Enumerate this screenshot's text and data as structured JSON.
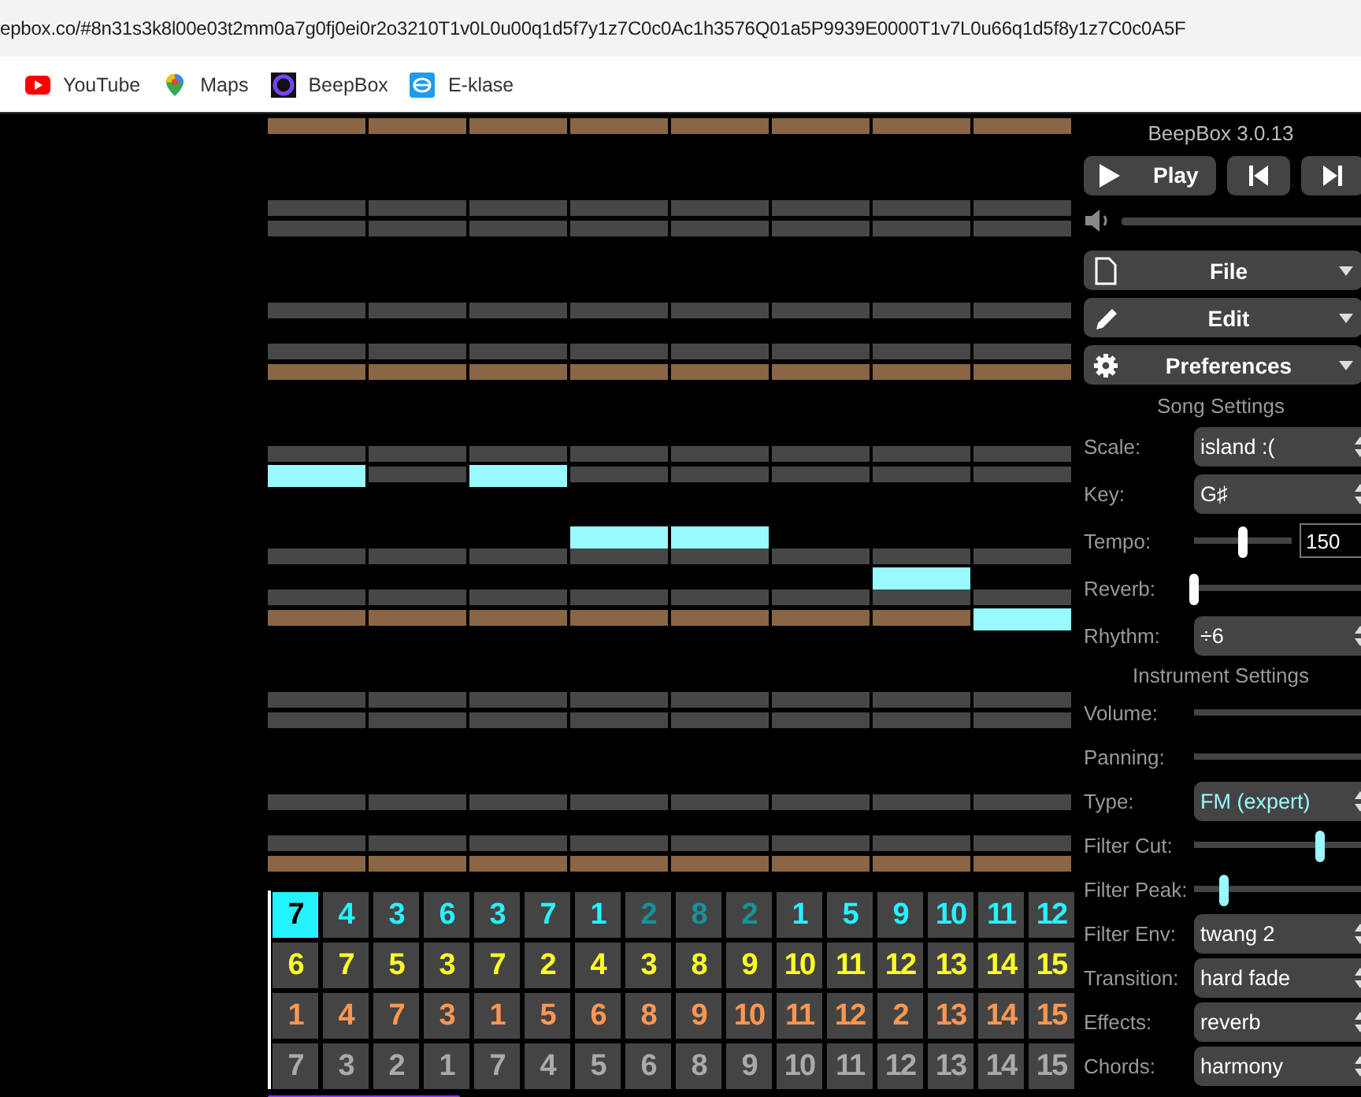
{
  "browser": {
    "url": "epbox.co/#8n31s3k8l00e03t2mm0a7g0fj0ei0r2o3210T1v0L0u00q1d5f7y1z7C0c0Ac1h3576Q01a5P9939E0000T1v7L0u66q1d5f8y1z7C0c0A5F",
    "bookmarks": [
      {
        "kind": "youtube",
        "label": "YouTube"
      },
      {
        "kind": "maps",
        "label": "Maps"
      },
      {
        "kind": "beepbox",
        "label": "BeepBox"
      },
      {
        "kind": "eklase",
        "label": "E-klase"
      }
    ]
  },
  "note_editor": {
    "rows": [
      {
        "kind": "tonic",
        "notes": [
          false,
          false,
          false,
          false,
          false,
          false,
          false,
          false
        ]
      },
      {
        "kind": "empty",
        "notes": [
          false,
          false,
          false,
          false,
          false,
          false,
          false,
          false
        ]
      },
      {
        "kind": "empty",
        "notes": [
          false,
          false,
          false,
          false,
          false,
          false,
          false,
          false
        ]
      },
      {
        "kind": "empty",
        "notes": [
          false,
          false,
          false,
          false,
          false,
          false,
          false,
          false
        ]
      },
      {
        "kind": "key",
        "notes": [
          false,
          false,
          false,
          false,
          false,
          false,
          false,
          false
        ]
      },
      {
        "kind": "key",
        "notes": [
          false,
          false,
          false,
          false,
          false,
          false,
          false,
          false
        ]
      },
      {
        "kind": "empty",
        "notes": [
          false,
          false,
          false,
          false,
          false,
          false,
          false,
          false
        ]
      },
      {
        "kind": "empty",
        "notes": [
          false,
          false,
          false,
          false,
          false,
          false,
          false,
          false
        ]
      },
      {
        "kind": "empty",
        "notes": [
          false,
          false,
          false,
          false,
          false,
          false,
          false,
          false
        ]
      },
      {
        "kind": "key",
        "notes": [
          false,
          false,
          false,
          false,
          false,
          false,
          false,
          false
        ]
      },
      {
        "kind": "empty",
        "notes": [
          false,
          false,
          false,
          false,
          false,
          false,
          false,
          false
        ]
      },
      {
        "kind": "key",
        "notes": [
          false,
          false,
          false,
          false,
          false,
          false,
          false,
          false
        ]
      },
      {
        "kind": "tonic",
        "notes": [
          false,
          false,
          false,
          false,
          false,
          false,
          false,
          false
        ]
      },
      {
        "kind": "empty",
        "notes": [
          false,
          false,
          false,
          false,
          false,
          false,
          false,
          false
        ]
      },
      {
        "kind": "empty",
        "notes": [
          false,
          false,
          false,
          false,
          false,
          false,
          false,
          false
        ]
      },
      {
        "kind": "empty",
        "notes": [
          false,
          false,
          false,
          false,
          false,
          false,
          false,
          false
        ]
      },
      {
        "kind": "key",
        "notes": [
          false,
          false,
          false,
          false,
          false,
          false,
          false,
          false
        ]
      },
      {
        "kind": "key",
        "notes": [
          true,
          false,
          true,
          false,
          false,
          false,
          false,
          false
        ]
      },
      {
        "kind": "empty",
        "notes": [
          false,
          false,
          false,
          false,
          false,
          false,
          false,
          false
        ]
      },
      {
        "kind": "empty",
        "notes": [
          false,
          false,
          false,
          false,
          false,
          false,
          false,
          false
        ]
      },
      {
        "kind": "empty",
        "notes": [
          false,
          false,
          false,
          true,
          true,
          false,
          false,
          false
        ]
      },
      {
        "kind": "key",
        "notes": [
          false,
          false,
          false,
          false,
          false,
          false,
          false,
          false
        ]
      },
      {
        "kind": "empty",
        "notes": [
          false,
          false,
          false,
          false,
          false,
          false,
          true,
          false
        ]
      },
      {
        "kind": "key",
        "notes": [
          false,
          false,
          false,
          false,
          false,
          false,
          false,
          false
        ]
      },
      {
        "kind": "tonic",
        "notes": [
          false,
          false,
          false,
          false,
          false,
          false,
          false,
          true
        ]
      },
      {
        "kind": "empty",
        "notes": [
          false,
          false,
          false,
          false,
          false,
          false,
          false,
          false
        ]
      },
      {
        "kind": "empty",
        "notes": [
          false,
          false,
          false,
          false,
          false,
          false,
          false,
          false
        ]
      },
      {
        "kind": "empty",
        "notes": [
          false,
          false,
          false,
          false,
          false,
          false,
          false,
          false
        ]
      },
      {
        "kind": "key",
        "notes": [
          false,
          false,
          false,
          false,
          false,
          false,
          false,
          false
        ]
      },
      {
        "kind": "key",
        "notes": [
          false,
          false,
          false,
          false,
          false,
          false,
          false,
          false
        ]
      },
      {
        "kind": "empty",
        "notes": [
          false,
          false,
          false,
          false,
          false,
          false,
          false,
          false
        ]
      },
      {
        "kind": "empty",
        "notes": [
          false,
          false,
          false,
          false,
          false,
          false,
          false,
          false
        ]
      },
      {
        "kind": "empty",
        "notes": [
          false,
          false,
          false,
          false,
          false,
          false,
          false,
          false
        ]
      },
      {
        "kind": "key",
        "notes": [
          false,
          false,
          false,
          false,
          false,
          false,
          false,
          false
        ]
      },
      {
        "kind": "empty",
        "notes": [
          false,
          false,
          false,
          false,
          false,
          false,
          false,
          false
        ]
      },
      {
        "kind": "key",
        "notes": [
          false,
          false,
          false,
          false,
          false,
          false,
          false,
          false
        ]
      },
      {
        "kind": "tonic",
        "notes": [
          false,
          false,
          false,
          false,
          false,
          false,
          false,
          false
        ]
      }
    ]
  },
  "track_editor": {
    "channels": [
      {
        "color": "#25f3ff",
        "cells": [
          {
            "text": "7",
            "selected": true,
            "dim": false
          },
          {
            "text": "4",
            "selected": false,
            "dim": false
          },
          {
            "text": "3",
            "selected": false,
            "dim": false
          },
          {
            "text": "6",
            "selected": false,
            "dim": false
          },
          {
            "text": "3",
            "selected": false,
            "dim": false
          },
          {
            "text": "7",
            "selected": false,
            "dim": false
          },
          {
            "text": "1",
            "selected": false,
            "dim": false
          },
          {
            "text": "2",
            "selected": false,
            "dim": true
          },
          {
            "text": "8",
            "selected": false,
            "dim": true
          },
          {
            "text": "2",
            "selected": false,
            "dim": true
          },
          {
            "text": "1",
            "selected": false,
            "dim": false
          },
          {
            "text": "5",
            "selected": false,
            "dim": false
          },
          {
            "text": "9",
            "selected": false,
            "dim": false
          },
          {
            "text": "10",
            "selected": false,
            "dim": false
          },
          {
            "text": "11",
            "selected": false,
            "dim": false
          },
          {
            "text": "12",
            "selected": false,
            "dim": false
          }
        ]
      },
      {
        "color": "#ffff25",
        "cells": [
          {
            "text": "6",
            "selected": false,
            "dim": false
          },
          {
            "text": "7",
            "selected": false,
            "dim": false
          },
          {
            "text": "5",
            "selected": false,
            "dim": false
          },
          {
            "text": "3",
            "selected": false,
            "dim": false
          },
          {
            "text": "7",
            "selected": false,
            "dim": false
          },
          {
            "text": "2",
            "selected": false,
            "dim": false
          },
          {
            "text": "4",
            "selected": false,
            "dim": false
          },
          {
            "text": "3",
            "selected": false,
            "dim": false
          },
          {
            "text": "8",
            "selected": false,
            "dim": false
          },
          {
            "text": "9",
            "selected": false,
            "dim": false
          },
          {
            "text": "10",
            "selected": false,
            "dim": false
          },
          {
            "text": "11",
            "selected": false,
            "dim": false
          },
          {
            "text": "12",
            "selected": false,
            "dim": false
          },
          {
            "text": "13",
            "selected": false,
            "dim": false
          },
          {
            "text": "14",
            "selected": false,
            "dim": false
          },
          {
            "text": "15",
            "selected": false,
            "dim": false
          }
        ]
      },
      {
        "color": "#ff9752",
        "cells": [
          {
            "text": "1",
            "selected": false,
            "dim": false
          },
          {
            "text": "4",
            "selected": false,
            "dim": false
          },
          {
            "text": "7",
            "selected": false,
            "dim": false
          },
          {
            "text": "3",
            "selected": false,
            "dim": false
          },
          {
            "text": "1",
            "selected": false,
            "dim": false
          },
          {
            "text": "5",
            "selected": false,
            "dim": false
          },
          {
            "text": "6",
            "selected": false,
            "dim": false
          },
          {
            "text": "8",
            "selected": false,
            "dim": false
          },
          {
            "text": "9",
            "selected": false,
            "dim": false
          },
          {
            "text": "10",
            "selected": false,
            "dim": false
          },
          {
            "text": "11",
            "selected": false,
            "dim": false
          },
          {
            "text": "12",
            "selected": false,
            "dim": false
          },
          {
            "text": "2",
            "selected": false,
            "dim": false
          },
          {
            "text": "13",
            "selected": false,
            "dim": false
          },
          {
            "text": "14",
            "selected": false,
            "dim": false
          },
          {
            "text": "15",
            "selected": false,
            "dim": false
          }
        ]
      },
      {
        "color": "#aaaaaa",
        "cells": [
          {
            "text": "7",
            "selected": false,
            "dim": false
          },
          {
            "text": "3",
            "selected": false,
            "dim": false
          },
          {
            "text": "2",
            "selected": false,
            "dim": false
          },
          {
            "text": "1",
            "selected": false,
            "dim": false
          },
          {
            "text": "7",
            "selected": false,
            "dim": false
          },
          {
            "text": "4",
            "selected": false,
            "dim": false
          },
          {
            "text": "5",
            "selected": false,
            "dim": false
          },
          {
            "text": "6",
            "selected": false,
            "dim": false
          },
          {
            "text": "8",
            "selected": false,
            "dim": false
          },
          {
            "text": "9",
            "selected": false,
            "dim": false
          },
          {
            "text": "10",
            "selected": false,
            "dim": false
          },
          {
            "text": "11",
            "selected": false,
            "dim": false
          },
          {
            "text": "12",
            "selected": false,
            "dim": false
          },
          {
            "text": "13",
            "selected": false,
            "dim": false
          },
          {
            "text": "14",
            "selected": false,
            "dim": false
          },
          {
            "text": "15",
            "selected": false,
            "dim": false
          }
        ]
      }
    ]
  },
  "panel": {
    "title": "BeepBox 3.0.13",
    "transport": [
      {
        "kind": "play",
        "label": "Play"
      },
      {
        "kind": "prev"
      },
      {
        "kind": "next"
      }
    ],
    "master_volume": {
      "level": 1
    },
    "menus": [
      {
        "kind": "file",
        "label": "File"
      },
      {
        "kind": "edit",
        "label": "Edit"
      },
      {
        "kind": "preferences",
        "label": "Preferences"
      }
    ],
    "song_settings": {
      "title": "Song Settings",
      "rows": [
        {
          "kind": "select",
          "label": "Scale:",
          "value": "island :(",
          "accent": false
        },
        {
          "kind": "select",
          "label": "Key:",
          "value": "G♯",
          "accent": false
        },
        {
          "kind": "slider_number",
          "label": "Tempo:",
          "level": 0.5,
          "value": "150",
          "accent": false
        },
        {
          "kind": "slider",
          "label": "Reverb:",
          "level": 0,
          "accent": false
        },
        {
          "kind": "select",
          "label": "Rhythm:",
          "value": "÷6",
          "accent": false
        }
      ]
    },
    "instrument_settings": {
      "title": "Instrument Settings",
      "rows": [
        {
          "kind": "slider",
          "label": "Volume:",
          "level": 1
        },
        {
          "kind": "slider",
          "label": "Panning:",
          "level": 1
        },
        {
          "kind": "select",
          "label": "Type:",
          "value": "FM (expert)",
          "accent": true
        },
        {
          "kind": "slider",
          "label": "Filter Cut:",
          "level": 0.68,
          "accent": true
        },
        {
          "kind": "slider",
          "label": "Filter Peak:",
          "level": 0.16,
          "accent": true
        },
        {
          "kind": "select",
          "label": "Filter Env:",
          "value": "twang 2",
          "accent": false
        },
        {
          "kind": "select",
          "label": "Transition:",
          "value": "hard fade",
          "accent": false
        },
        {
          "kind": "select",
          "label": "Effects:",
          "value": "reverb",
          "accent": false
        },
        {
          "kind": "select",
          "label": "Chords:",
          "value": "harmony",
          "accent": false
        }
      ]
    }
  }
}
